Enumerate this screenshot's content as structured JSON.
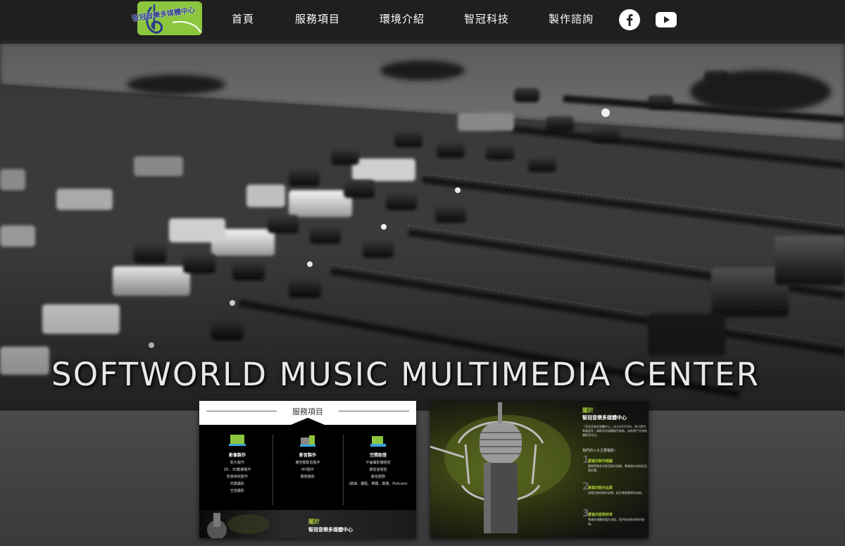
{
  "nav": {
    "logo_text": "智冠音樂多媒體中心",
    "items": [
      {
        "label": "首頁"
      },
      {
        "label": "服務項目"
      },
      {
        "label": "環境介紹"
      },
      {
        "label": "智冠科技"
      },
      {
        "label": "製作諮詢"
      }
    ],
    "social": [
      {
        "icon": "facebook-icon"
      },
      {
        "icon": "youtube-icon"
      }
    ]
  },
  "hero": {
    "title": "SOFTWORLD MUSIC MULTIMEDIA CENTER"
  },
  "services_card": {
    "title": "服務項目",
    "columns": [
      {
        "name": "影像製作",
        "items": [
          "影片製作",
          "2D、3D動畫製作",
          "影像特效製作",
          "商業攝影",
          "空拍攝影"
        ]
      },
      {
        "name": "影音製作",
        "items": [
          "廣告類影音製作",
          "MV製作",
          "動態錄影"
        ]
      },
      {
        "name": "空間租借",
        "items": [
          "平面攝影棚租借",
          "錄音室租借",
          "錄音服務",
          "(歌曲、課程、樂器、廣播、Podcast)"
        ]
      }
    ],
    "about_label": "關於",
    "about_name": "智冠音樂多媒體中心"
  },
  "about_card": {
    "heading": "關於",
    "name": "智冠音樂多媒體中心",
    "intro": "「智冠音樂多媒體中心」成立於2018年，致力提供專業錄音、攝影與多媒體製作服務，協助客戶完成各類影音作品。",
    "lead": "我們的三大主要優勢：",
    "points": [
      {
        "num": "1",
        "title": "豐富的製作經驗",
        "desc": "團隊累積多年影音製作經驗，專業製作流程與品質把關。"
      },
      {
        "num": "2",
        "title": "專業的製作品質",
        "desc": "具備完善的製作設備，配合專業團隊的協助。"
      },
      {
        "num": "3",
        "title": "豐富的服務效率",
        "desc": "專業的規劃與製作流程，提供快速有效率的服務。"
      }
    ]
  },
  "colors": {
    "accent_green": "#a5c83a",
    "logo_green": "#8cc63f",
    "logo_blue": "#2b3a8c",
    "nav_bg": "#1e1e1e"
  }
}
